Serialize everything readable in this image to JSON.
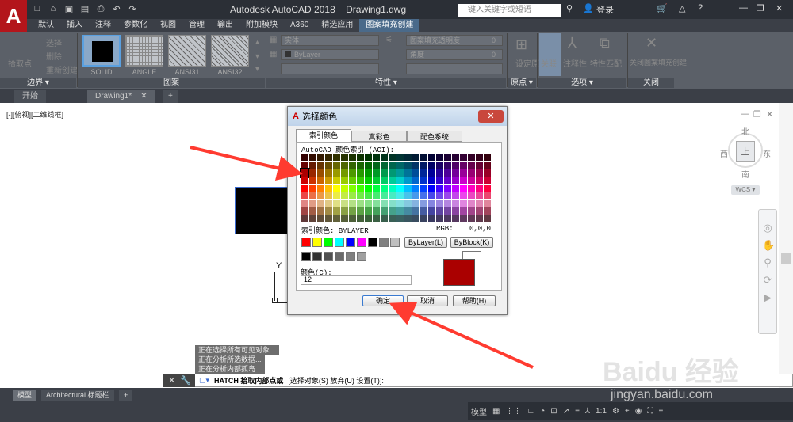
{
  "titlebar": {
    "app_title": "Autodesk AutoCAD 2018",
    "doc_title": "Drawing1.dwg",
    "search_placeholder": "键入关键字或短语",
    "signin": "登录"
  },
  "ribbon_tabs": [
    "默认",
    "插入",
    "注释",
    "参数化",
    "视图",
    "管理",
    "输出",
    "附加模块",
    "A360",
    "精选应用",
    "图案填充创建"
  ],
  "active_ribbon_tab": "图案填充创建",
  "ribbon": {
    "boundary": {
      "pick": "拾取点",
      "select": "选择",
      "remove": "删除",
      "recreate": "重新创建",
      "label": "边界"
    },
    "pattern": {
      "label": "图案",
      "items": [
        {
          "name": "SOLID",
          "selected": true
        },
        {
          "name": "ANGLE"
        },
        {
          "name": "ANSI31"
        },
        {
          "name": "ANSI32"
        }
      ]
    },
    "properties": {
      "label": "特性",
      "type_value": "实体",
      "color_value": "ByLayer",
      "transparency_label": "图案填充透明度",
      "transparency_value": "0",
      "angle_label": "角度",
      "angle_value": "0"
    },
    "origin": {
      "label": "原点",
      "set": "设定原点"
    },
    "options": {
      "label": "选项",
      "associative": "关联",
      "annotative": "注释性",
      "match": "特性匹配"
    },
    "close": {
      "label": "关闭",
      "button": "关闭图案填充创建"
    }
  },
  "doc_tabs": [
    "开始",
    "Drawing1*"
  ],
  "canvas": {
    "view_label": "[-][俯视][二维线框]",
    "compass": {
      "n": "北",
      "s": "南",
      "e": "东",
      "w": "西",
      "top": "上"
    },
    "wcs": "WCS",
    "axis_y": "Y"
  },
  "dialog": {
    "title": "选择颜色",
    "tabs": [
      "索引颜色",
      "真彩色",
      "配色系统"
    ],
    "active_tab": "索引颜色",
    "aci_label": "AutoCAD 颜色索引 (ACI):",
    "index_label": "索引颜色: BYLAYER",
    "rgb_label": "RGB:",
    "rgb_value": "0,0,0",
    "bylayer_btn": "ByLayer(L)",
    "byblock_btn": "ByBlock(K)",
    "color_field_label": "颜色(C):",
    "color_value": "12",
    "ok": "确定",
    "cancel": "取消",
    "help": "帮助(H)",
    "new_color": "#aa0000",
    "standard_colors": [
      "#ff0000",
      "#ffff00",
      "#00ff00",
      "#00ffff",
      "#0000ff",
      "#ff00ff",
      "#000000",
      "#808080",
      "#c0c0c0"
    ],
    "gray_colors": [
      "#000000",
      "#333333",
      "#505050",
      "#696969",
      "#808080",
      "#a0a0a0",
      "#c0c0c0",
      "#ffffff"
    ]
  },
  "command": {
    "history": [
      "正在选择所有可见对象...",
      "正在分析所选数据...",
      "正在分析内部孤岛..."
    ],
    "prompt": "HATCH 拾取内部点或",
    "options": "[选择对象(S) 放弃(U) 设置(T)]:"
  },
  "layout_tabs": [
    "模型",
    "Architectural 标题栏"
  ],
  "status": {
    "model": "模型",
    "scale": "1:1"
  },
  "watermark": {
    "brand": "Baidu 经验",
    "url": "jingyan.baidu.com"
  }
}
